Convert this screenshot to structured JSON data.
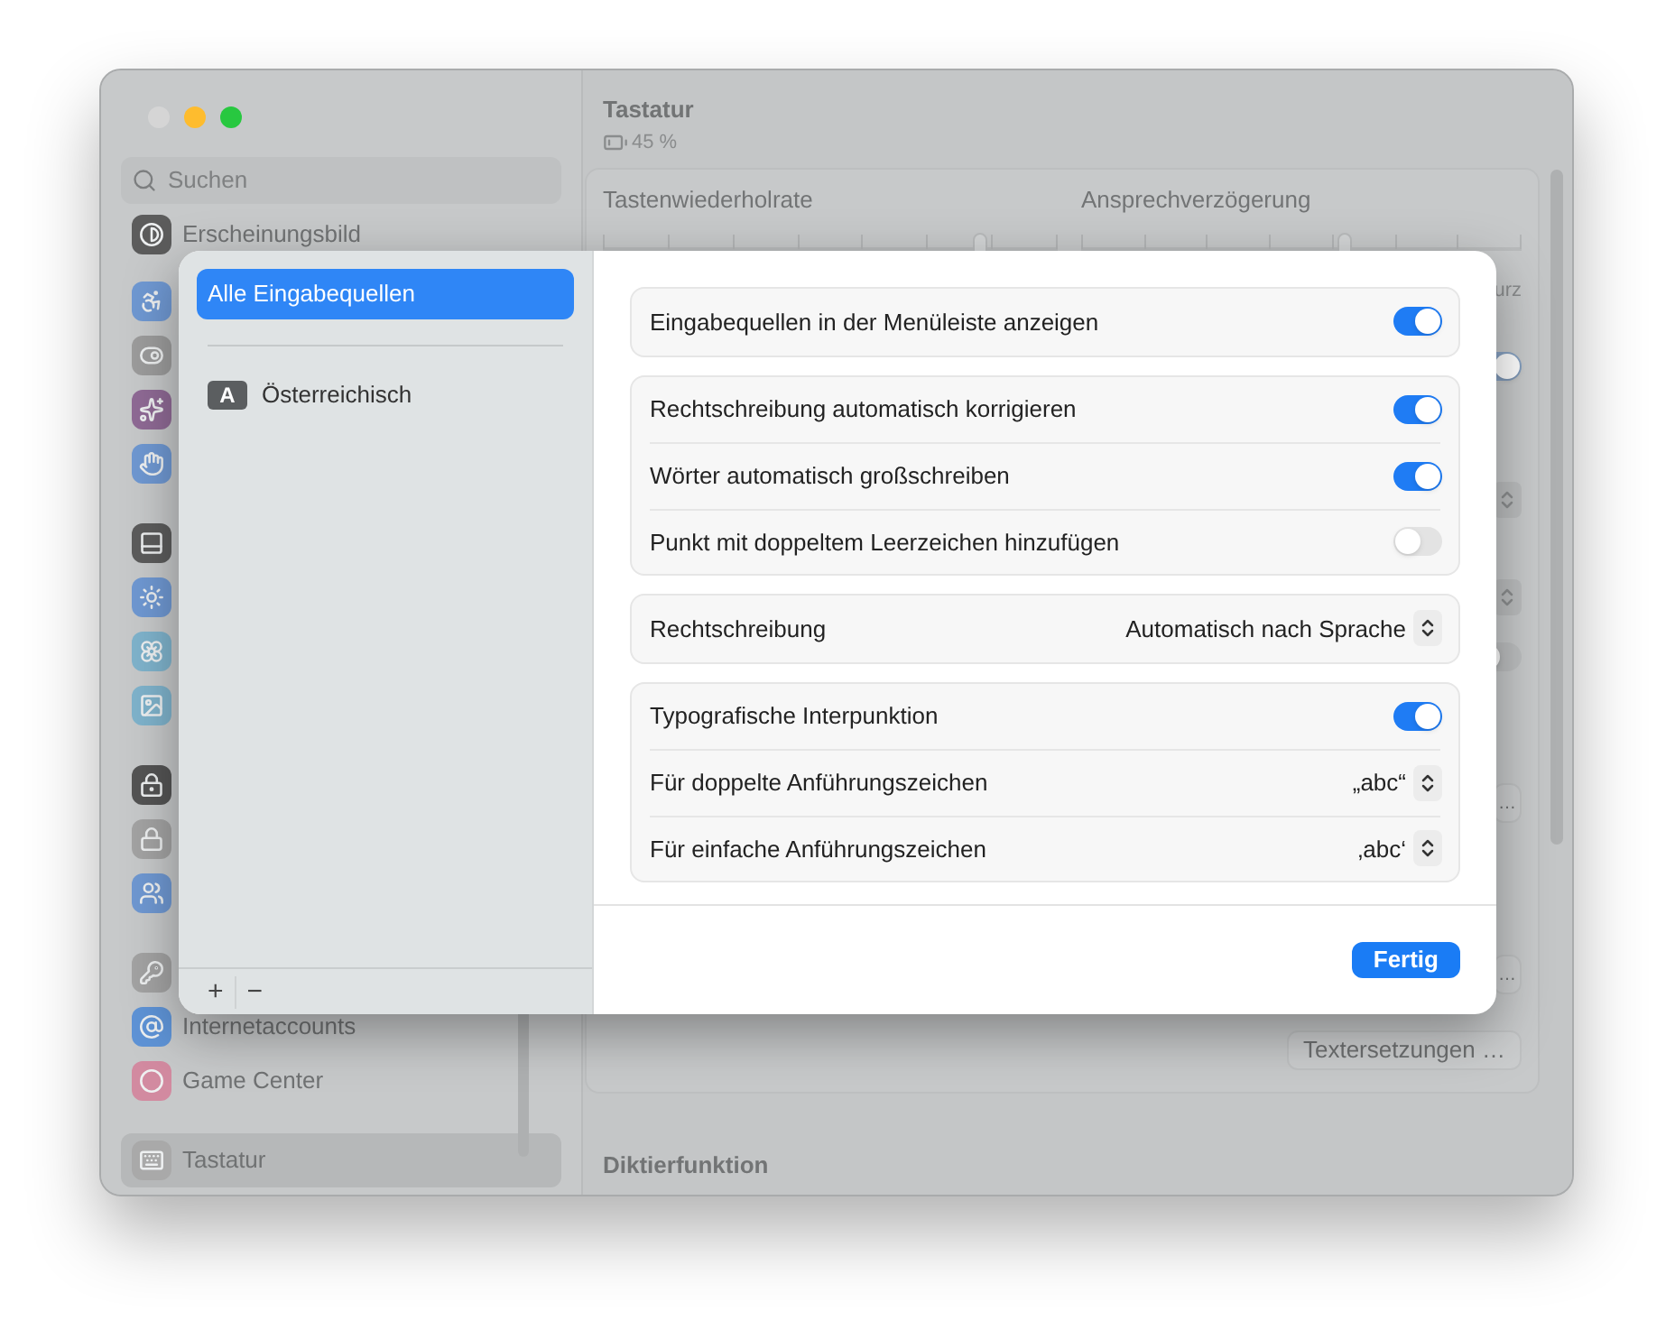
{
  "window": {
    "traffic_lights": [
      {
        "color": "#d5d5d5"
      },
      {
        "color": "#febc2e"
      },
      {
        "color": "#28c840"
      }
    ]
  },
  "search": {
    "placeholder": "Suchen"
  },
  "sidebar": {
    "items": [
      {
        "label": "Erscheinungsbild",
        "selected": false
      },
      {
        "label": "Internetaccounts",
        "selected": false
      },
      {
        "label": "Game Center",
        "selected": false
      },
      {
        "label": "Tastatur",
        "selected": true
      }
    ]
  },
  "content": {
    "title": "Tastatur",
    "battery_reading": "45 %",
    "sliders": [
      {
        "label": "Tastenwiederholrate",
        "level": 0.83
      },
      {
        "label": "Ansprechverzögerung",
        "level": 0.6
      }
    ],
    "edge_text": "urz",
    "edge_controls": [
      {
        "kind": "toggle",
        "on": true
      },
      {
        "kind": "stepper"
      },
      {
        "kind": "stepper"
      },
      {
        "kind": "toggle",
        "on": false
      },
      {
        "kind": "button",
        "label": "…"
      },
      {
        "kind": "button",
        "label": "…"
      },
      {
        "kind": "button",
        "label": "Textersetzungen …"
      }
    ],
    "section_title": "Diktierfunktion"
  },
  "sheet": {
    "sources": [
      {
        "kind": "all",
        "label": "Alle Eingabequellen",
        "selected": true
      },
      {
        "kind": "layout",
        "badge": "A",
        "label": "Österreichisch",
        "selected": false
      }
    ],
    "toolbar": [
      "+",
      "−"
    ],
    "groups": [
      [
        {
          "kind": "toggle",
          "label": "Eingabequellen in der Menüleiste anzeigen",
          "on": true
        }
      ],
      [
        {
          "kind": "toggle",
          "label": "Rechtschreibung automatisch korrigieren",
          "on": true
        },
        {
          "kind": "toggle",
          "label": "Wörter automatisch großschreiben",
          "on": true
        },
        {
          "kind": "toggle",
          "label": "Punkt mit doppeltem Leerzeichen hinzufügen",
          "on": false
        }
      ],
      [
        {
          "kind": "popup",
          "label": "Rechtschreibung",
          "value": "Automatisch nach Sprache"
        }
      ],
      [
        {
          "kind": "toggle",
          "label": "Typografische Interpunktion",
          "on": true
        },
        {
          "kind": "popup",
          "label": "Für doppelte Anführungszeichen",
          "value": "„abc“"
        },
        {
          "kind": "popup",
          "label": "Für einfache Anführungszeichen",
          "value": "‚abc‘"
        }
      ]
    ],
    "done_button": "Fertig"
  }
}
